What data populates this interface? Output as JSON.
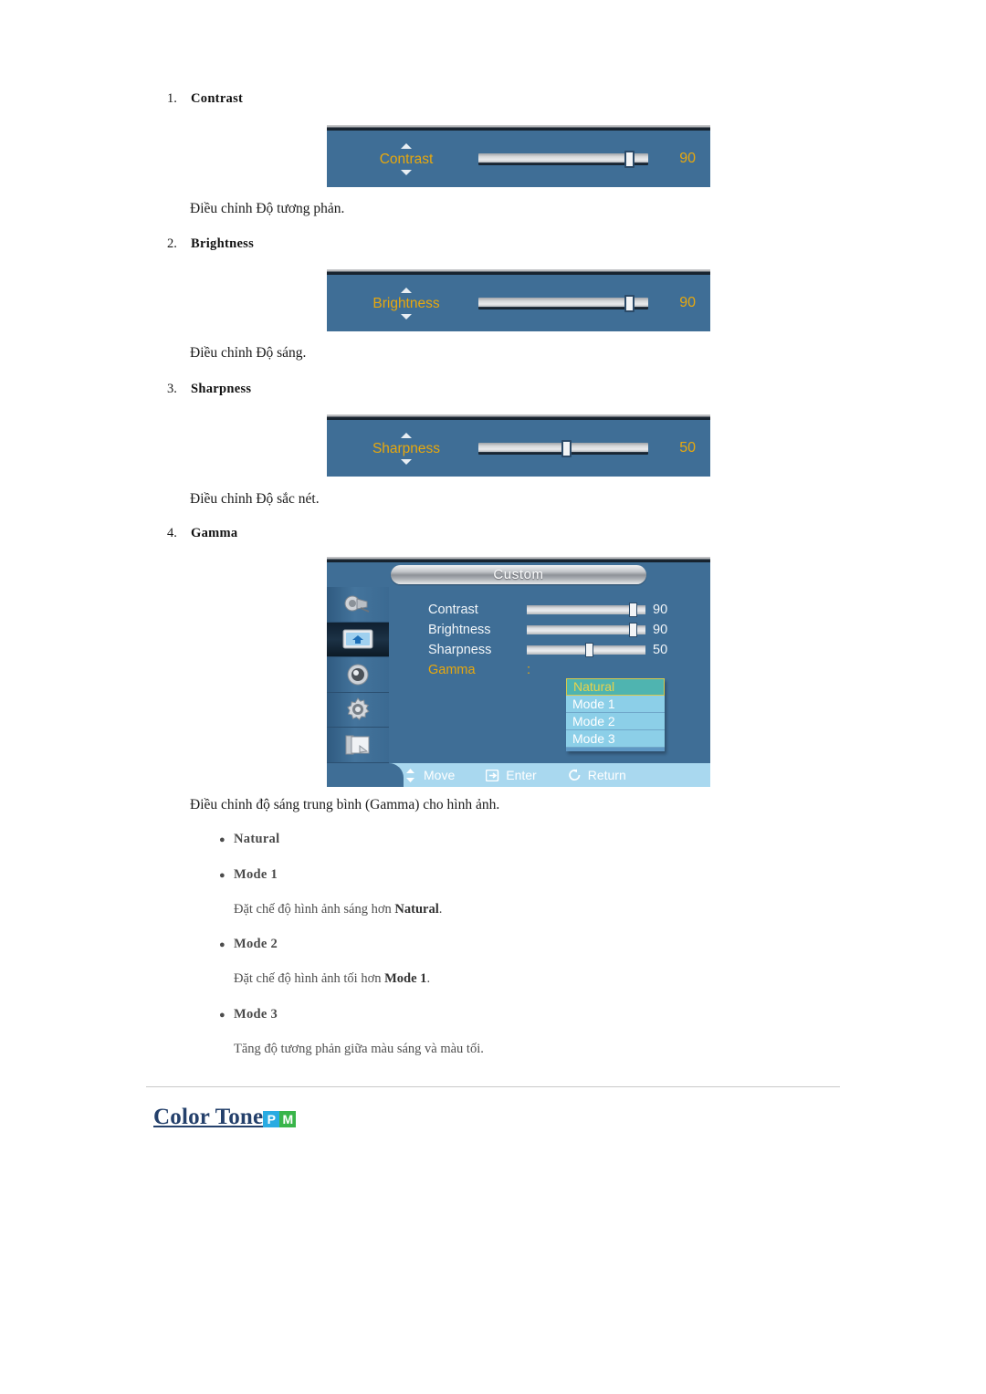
{
  "sections": [
    {
      "number": "1.",
      "label": "Contrast",
      "caption": "Điều chỉnh Độ tương phản.",
      "osd": {
        "name": "Contrast",
        "value": "90",
        "percent": 86
      }
    },
    {
      "number": "2.",
      "label": "Brightness",
      "caption": "Điều chỉnh Độ sáng.",
      "osd": {
        "name": "Brightness",
        "value": "90",
        "percent": 86
      }
    },
    {
      "number": "3.",
      "label": "Sharpness",
      "caption": "Điều chỉnh Độ sắc nét.",
      "osd": {
        "name": "Sharpness",
        "value": "50",
        "percent": 49
      }
    },
    {
      "number": "4.",
      "label": "Gamma",
      "caption": "Điều chỉnh độ sáng trung bình (Gamma) cho hình ảnh."
    }
  ],
  "gamma_menu": {
    "title": "Custom",
    "rail_icons": [
      "input-source-icon",
      "picture-icon",
      "sound-icon",
      "setup-gear-icon",
      "multi-control-icon"
    ],
    "rows": [
      {
        "label": "Contrast",
        "value": "90",
        "percent": 86
      },
      {
        "label": "Brightness",
        "value": "90",
        "percent": 86
      },
      {
        "label": "Sharpness",
        "value": "50",
        "percent": 49
      }
    ],
    "gamma_label": "Gamma",
    "gamma_colon": ":",
    "options": [
      "Natural",
      "Mode 1",
      "Mode 2",
      "Mode 3"
    ],
    "selected_option": "Natural",
    "footer": [
      {
        "icon": "up-down-arrows-icon",
        "label": "Move"
      },
      {
        "icon": "enter-key-icon",
        "label": "Enter"
      },
      {
        "icon": "return-arrow-icon",
        "label": "Return"
      }
    ]
  },
  "gamma_bullets": [
    {
      "label": "Natural",
      "desc_parts": []
    },
    {
      "label": "Mode 1",
      "desc_parts": [
        {
          "t": "Đặt chế độ hình ảnh sáng hơn "
        },
        {
          "t": "Natural",
          "b": true
        },
        {
          "t": "."
        }
      ]
    },
    {
      "label": "Mode 2",
      "desc_parts": [
        {
          "t": "Đặt chế độ hình ảnh tối hơn "
        },
        {
          "t": "Mode 1",
          "b": true
        },
        {
          "t": "."
        }
      ]
    },
    {
      "label": "Mode 3",
      "desc_parts": [
        {
          "t": "Tăng độ tương phản giữa màu sáng và màu tối."
        }
      ]
    }
  ],
  "bullet_descs": {
    "mode1": "Đặt chế độ hình ảnh sáng hơn Natural.",
    "mode2": "Đặt chế độ hình ảnh tối hơn Mode 1.",
    "mode3": "Tăng độ tương phản giữa màu sáng và màu tối."
  },
  "color_tone": {
    "title": "Color Tone",
    "badge_p": "P",
    "badge_m": "M",
    "badge_p_color": "#29abe2",
    "badge_m_color": "#39b54a"
  },
  "colors": {
    "osd_blue": "#3f6e96",
    "osd_gold": "#e8a80d",
    "dropdown_blue": "#8ccfe8",
    "dropdown_selected": "#4fb4b0",
    "footer_blue": "#a9d8ef",
    "heading_blue": "#24406b"
  }
}
